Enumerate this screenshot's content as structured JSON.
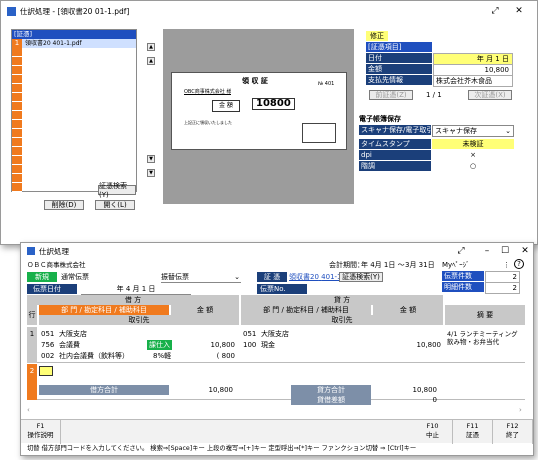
{
  "back_window": {
    "title": "仕訳処理 - [領収書20  01-1.pdf]",
    "list_header": "[証憑]",
    "list_rows": [
      {
        "num": "1",
        "name": "領収書20  401-1.pdf"
      }
    ],
    "buttons": {
      "evidence_search": "証憑検索(Y)",
      "delete": "削除(D)",
      "open": "開く(L)"
    },
    "receipt": {
      "title": "領 収 証",
      "no": "№ 401",
      "to": "OBC商事株式会社 様",
      "amount_label": "金 額",
      "amount": "10800",
      "note": "上記正に領収いたしました"
    },
    "side": {
      "correction": "修正",
      "section": "[証憑項目]",
      "date_label": "日付",
      "date_value": "年  月 1 日",
      "amount_label": "金額",
      "amount_value": "10,800",
      "payee_label": "支払先情報",
      "payee_value": "株式会社芥木食品",
      "prev": "前証憑(Z)",
      "page": "1 / 1",
      "next": "次証憑(X)",
      "storage_title": "電子帳簿保存",
      "scan_label": "スキャナ保存/電子取引",
      "scan_value": "スキャナ保存",
      "ts_label": "タイムスタンプ",
      "ts_value": "未検証",
      "dpi_label": "dpi",
      "dpi_value": "×",
      "color_label": "階調",
      "color_value": "○"
    }
  },
  "front_window": {
    "title": "仕訳処理",
    "company": "ＯＢＣ商事株式会社",
    "period_label": "会計期間：",
    "period_value": "年 4月 1日 〜",
    "period_end": "3月 31日",
    "mypage": "Myﾍﾟｰｼﾞ",
    "new_label": "新規",
    "slip_type": "通常伝票",
    "transfer": "振替伝票",
    "evidence_label": "証 憑",
    "evidence_value1": "領収書20",
    "evidence_value2": "401-1",
    "evidence_search": "証憑検索(Y)",
    "slip_date_label": "伝票日付",
    "slip_date_value": "年   4 月  1 日",
    "slip_no_label": "伝票No.",
    "slip_count_label": "伝票件数",
    "slip_count": "2",
    "detail_count_label": "明細件数",
    "detail_count": "2",
    "debit_header": "借 方",
    "credit_header": "貸 方",
    "row_label": "行",
    "dept_header": "部 門 / 勘定科目 / 補助科目",
    "amount_header": "金 額",
    "partner_header": "取引先",
    "summary_header": "摘 要",
    "rows": [
      {
        "num": "1",
        "d_dept": "051",
        "d_dept_name": "大阪支店",
        "d_acct": "756",
        "d_acct_name": "会議費",
        "d_tax": "課仕入",
        "d_amount": "10,800",
        "d_sub": "002",
        "d_sub_name": "社内会議費（飲料等）",
        "d_rate": "8%軽",
        "d_tax_amt": "( 800",
        "c_dept": "051",
        "c_dept_name": "大阪支店",
        "c_acct": "100",
        "c_acct_name": "現金",
        "c_amount": "10,800",
        "summary": "4/1 ランチミーティング 飲み物・お弁当代"
      },
      {
        "num": "2"
      }
    ],
    "debit_total_label": "借方合計",
    "debit_total": "10,800",
    "credit_total_label": "貸方合計",
    "credit_total": "10,800",
    "diff_label": "貸借差額",
    "diff_value": "0",
    "fkeys": [
      {
        "k": "F1",
        "l": "操作説明"
      },
      {
        "k": "F10",
        "l": "中止"
      },
      {
        "k": "F11",
        "l": "証憑"
      },
      {
        "k": "F12",
        "l": "終了"
      }
    ],
    "status": "切替    借方部門コードを入力してください。 検索⇒[Space]キー  上段の複写⇒[+]キー  定型呼出⇒[*]キー  ファンクション切替 ⇒ [Ctrl]キー"
  }
}
